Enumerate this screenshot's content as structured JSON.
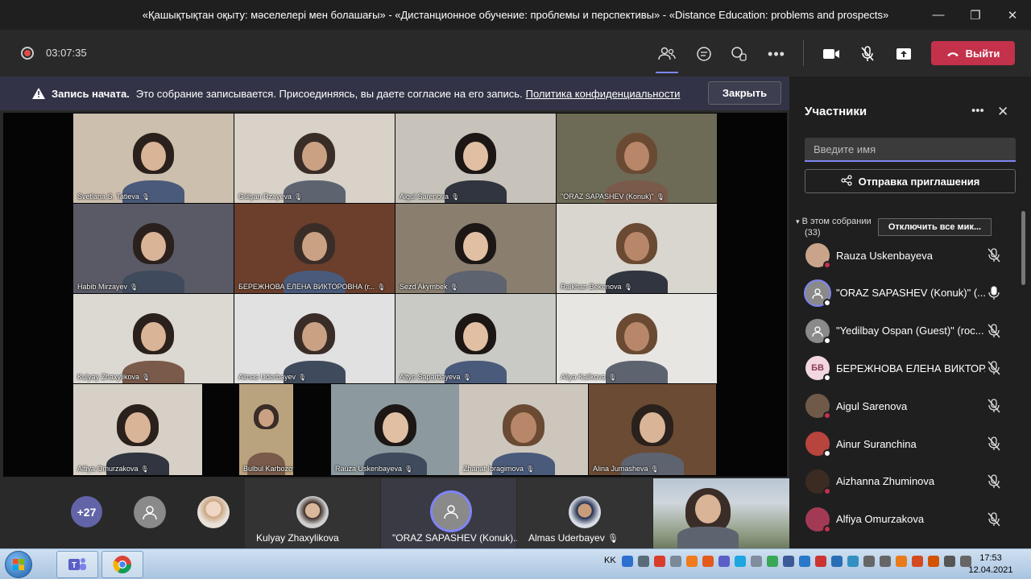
{
  "window": {
    "title": "«Қашықтықтан оқыту: мәселелері мен болашағы» - «Дистанционное обучение: проблемы и перспективы» - «Distance Education: problems and prospects»"
  },
  "meeting": {
    "timer": "03:07:35",
    "leave_label": "Выйти"
  },
  "banner": {
    "bold": "Запись начата.",
    "text": "Это собрание записывается. Присоединяясь, вы даете согласие на его запись.",
    "link": "Политика конфиденциальности",
    "close_label": "Закрыть"
  },
  "tiles": [
    {
      "name": "Svetlana S. Tatieva",
      "bg": "#cdbfae"
    },
    {
      "name": "Gülşan Rzayeva",
      "bg": "#d8d2c8"
    },
    {
      "name": "Aigul Sarenova",
      "bg": "#c7c3bb"
    },
    {
      "name": "\"ORAZ SAPASHEV (Konuk)\"",
      "bg": "#6d6a55"
    },
    {
      "name": "Habib Mirzayev",
      "bg": "#5a5a66"
    },
    {
      "name": "БЕРЕЖНОВА ЕЛЕНА ВИКТОРОВНА (г...",
      "bg": "#6b3f2c"
    },
    {
      "name": "Sezd Akymbek",
      "bg": "#8a7e6f"
    },
    {
      "name": "Raikhan Bekenova",
      "bg": "#d9d6cf"
    },
    {
      "name": "Kulyay Zhaxylikova",
      "bg": "#dcd8d2"
    },
    {
      "name": "Almas Uderbayev",
      "bg": "#e1e1e1"
    },
    {
      "name": "Altyn Saparbayeva",
      "bg": "#c9c9c6"
    },
    {
      "name": "Aliya Kalikova",
      "bg": "#e8e6e2"
    },
    {
      "name": "Alfiya Omurzakova",
      "bg": "#d6d0c6"
    },
    {
      "name": "Bulbul Karbozova",
      "bg": "#b9a37e"
    },
    {
      "name": "Rauza Uskenbayeva",
      "bg": "#8c9a9f"
    },
    {
      "name": "Zhanat Ibragimova",
      "bg": "#ccc6bd"
    },
    {
      "name": "Alina Jumasheva",
      "bg": "#6b4b34"
    }
  ],
  "strip": {
    "more_count": "+27",
    "tiles": [
      {
        "name": "Kulyay Zhaxylikova"
      },
      {
        "name": "\"ORAZ SAPASHEV (Konuk)..."
      },
      {
        "name": "Almas Uderbayev"
      }
    ]
  },
  "panel": {
    "title": "Участники",
    "search_placeholder": "Введите имя",
    "invite_label": "Отправка приглашения",
    "section_label": "В этом собрании",
    "section_count": "(33)",
    "mute_all_label": "Отключить все мик...",
    "participants": [
      {
        "name": "Rauza Uskenbayeva",
        "initials": "",
        "avatar_color": "#c9a48a",
        "status_color": "#c4314b",
        "mic": "muted"
      },
      {
        "name": "\"ORAZ SAPASHEV (Konuk)\" (...",
        "initials": "",
        "avatar_color": "#8a8a8a",
        "status_color": "#ffffff",
        "mic": "on"
      },
      {
        "name": "\"Yedilbay Ospan (Guest)\" (roc...",
        "initials": "",
        "avatar_color": "#8a8a8a",
        "status_color": "#ffffff",
        "mic": "muted"
      },
      {
        "name": "БЕРЕЖНОВА ЕЛЕНА ВИКТОР...",
        "initials": "БВ",
        "avatar_color": "#f2d7e0",
        "status_color": "#ffffff",
        "mic": "muted"
      },
      {
        "name": "Aigul Sarenova",
        "initials": "",
        "avatar_color": "#6f5a4a",
        "status_color": "#c4314b",
        "mic": "muted"
      },
      {
        "name": "Ainur Suranchina",
        "initials": "",
        "avatar_color": "#b7443d",
        "status_color": "#ffffff",
        "mic": "muted"
      },
      {
        "name": "Aizhanna Zhuminova",
        "initials": "",
        "avatar_color": "#3c2b23",
        "status_color": "#c4314b",
        "mic": "muted"
      },
      {
        "name": "Alfiya Omurzakova",
        "initials": "",
        "avatar_color": "#a23a56",
        "status_color": "#c4314b",
        "mic": "muted"
      }
    ]
  },
  "taskbar": {
    "lang": "KK",
    "time": "17:53",
    "date": "12.04.2021"
  }
}
